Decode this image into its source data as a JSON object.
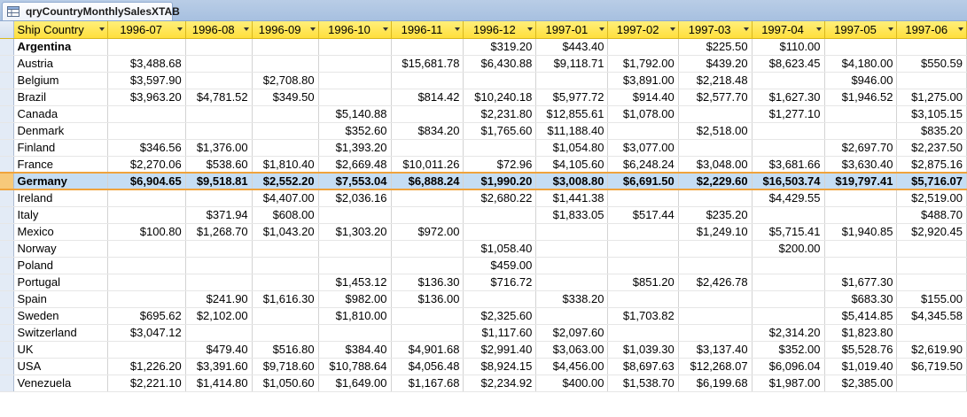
{
  "tab": {
    "title": "qryCountryMonthlySalesXTAB",
    "icon": "query-icon"
  },
  "columns": [
    "Ship Country",
    "1996-07",
    "1996-08",
    "1996-09",
    "1996-10",
    "1996-11",
    "1996-12",
    "1997-01",
    "1997-02",
    "1997-03",
    "1997-04",
    "1997-05",
    "1997-06"
  ],
  "rows": [
    {
      "country": "Argentina",
      "values": [
        "",
        "",
        "",
        "",
        "",
        "$319.20",
        "$443.40",
        "",
        "$225.50",
        "$110.00",
        ""
      ]
    },
    {
      "country": "Austria",
      "values": [
        "$3,488.68",
        "",
        "",
        "",
        "$15,681.78",
        "$6,430.88",
        "$9,118.71",
        "$1,792.00",
        "$439.20",
        "$8,623.45",
        "$4,180.00",
        "$550.59"
      ]
    },
    {
      "country": "Belgium",
      "values": [
        "$3,597.90",
        "",
        "$2,708.80",
        "",
        "",
        "",
        "",
        "$3,891.00",
        "$2,218.48",
        "",
        "$946.00",
        ""
      ]
    },
    {
      "country": "Brazil",
      "values": [
        "$3,963.20",
        "$4,781.52",
        "$349.50",
        "",
        "$814.42",
        "$10,240.18",
        "$5,977.72",
        "$914.40",
        "$2,577.70",
        "$1,627.30",
        "$1,946.52",
        "$1,275.00"
      ]
    },
    {
      "country": "Canada",
      "values": [
        "",
        "",
        "",
        "$5,140.88",
        "",
        "$2,231.80",
        "$12,855.61",
        "$1,078.00",
        "",
        "$1,277.10",
        "",
        "$3,105.15"
      ]
    },
    {
      "country": "Denmark",
      "values": [
        "",
        "",
        "",
        "$352.60",
        "$834.20",
        "$1,765.60",
        "$11,188.40",
        "",
        "$2,518.00",
        "",
        "",
        "$835.20"
      ]
    },
    {
      "country": "Finland",
      "values": [
        "$346.56",
        "$1,376.00",
        "",
        "$1,393.20",
        "",
        "",
        "$1,054.80",
        "$3,077.00",
        "",
        "",
        "$2,697.70",
        "$2,237.50"
      ]
    },
    {
      "country": "France",
      "values": [
        "$2,270.06",
        "$538.60",
        "$1,810.40",
        "$2,669.48",
        "$10,011.26",
        "$72.96",
        "$4,105.60",
        "$6,248.24",
        "$3,048.00",
        "$3,681.66",
        "$3,630.40",
        "$2,875.16"
      ]
    },
    {
      "country": "Germany",
      "values": [
        "$6,904.65",
        "$9,518.81",
        "$2,552.20",
        "$7,553.04",
        "$6,888.24",
        "$1,990.20",
        "$3,008.80",
        "$6,691.50",
        "$2,229.60",
        "$16,503.74",
        "$19,797.41",
        "$5,716.07"
      ]
    },
    {
      "country": "Ireland",
      "values": [
        "",
        "",
        "$4,407.00",
        "$2,036.16",
        "",
        "$2,680.22",
        "$1,441.38",
        "",
        "",
        "$4,429.55",
        "",
        "$2,519.00"
      ]
    },
    {
      "country": "Italy",
      "values": [
        "",
        "$371.94",
        "$608.00",
        "",
        "",
        "",
        "$1,833.05",
        "$517.44",
        "$235.20",
        "",
        "",
        "$488.70"
      ]
    },
    {
      "country": "Mexico",
      "values": [
        "$100.80",
        "$1,268.70",
        "$1,043.20",
        "$1,303.20",
        "$972.00",
        "",
        "",
        "",
        "$1,249.10",
        "$5,715.41",
        "$1,940.85",
        "$2,920.45"
      ]
    },
    {
      "country": "Norway",
      "values": [
        "",
        "",
        "",
        "",
        "",
        "$1,058.40",
        "",
        "",
        "",
        "$200.00",
        "",
        ""
      ]
    },
    {
      "country": "Poland",
      "values": [
        "",
        "",
        "",
        "",
        "",
        "$459.00",
        "",
        "",
        "",
        "",
        "",
        ""
      ]
    },
    {
      "country": "Portugal",
      "values": [
        "",
        "",
        "",
        "$1,453.12",
        "$136.30",
        "$716.72",
        "",
        "$851.20",
        "$2,426.78",
        "",
        "$1,677.30",
        ""
      ]
    },
    {
      "country": "Spain",
      "values": [
        "",
        "$241.90",
        "$1,616.30",
        "$982.00",
        "$136.00",
        "",
        "$338.20",
        "",
        "",
        "",
        "$683.30",
        "$155.00"
      ]
    },
    {
      "country": "Sweden",
      "values": [
        "$695.62",
        "$2,102.00",
        "",
        "$1,810.00",
        "",
        "$2,325.60",
        "",
        "$1,703.82",
        "",
        "",
        "$5,414.85",
        "$4,345.58"
      ]
    },
    {
      "country": "Switzerland",
      "values": [
        "$3,047.12",
        "",
        "",
        "",
        "",
        "$1,117.60",
        "$2,097.60",
        "",
        "",
        "$2,314.20",
        "$1,823.80",
        ""
      ]
    },
    {
      "country": "UK",
      "values": [
        "",
        "$479.40",
        "$516.80",
        "$384.40",
        "$4,901.68",
        "$2,991.40",
        "$3,063.00",
        "$1,039.30",
        "$3,137.40",
        "$352.00",
        "$5,528.76",
        "$2,619.90"
      ]
    },
    {
      "country": "USA",
      "values": [
        "$1,226.20",
        "$3,391.60",
        "$9,718.60",
        "$10,788.64",
        "$4,056.48",
        "$8,924.15",
        "$4,456.00",
        "$8,697.63",
        "$12,268.07",
        "$6,096.04",
        "$1,019.40",
        "$6,719.50"
      ]
    },
    {
      "country": "Venezuela",
      "values": [
        "$2,221.10",
        "$1,414.80",
        "$1,050.60",
        "$1,649.00",
        "$1,167.68",
        "$2,234.92",
        "$400.00",
        "$1,538.70",
        "$6,199.68",
        "$1,987.00",
        "$2,385.00",
        ""
      ]
    }
  ],
  "current_row": "Germany",
  "colors": {
    "header": "#ffe45a",
    "selected_row": "#c5ddf3",
    "selected_border": "#f0a33c"
  }
}
